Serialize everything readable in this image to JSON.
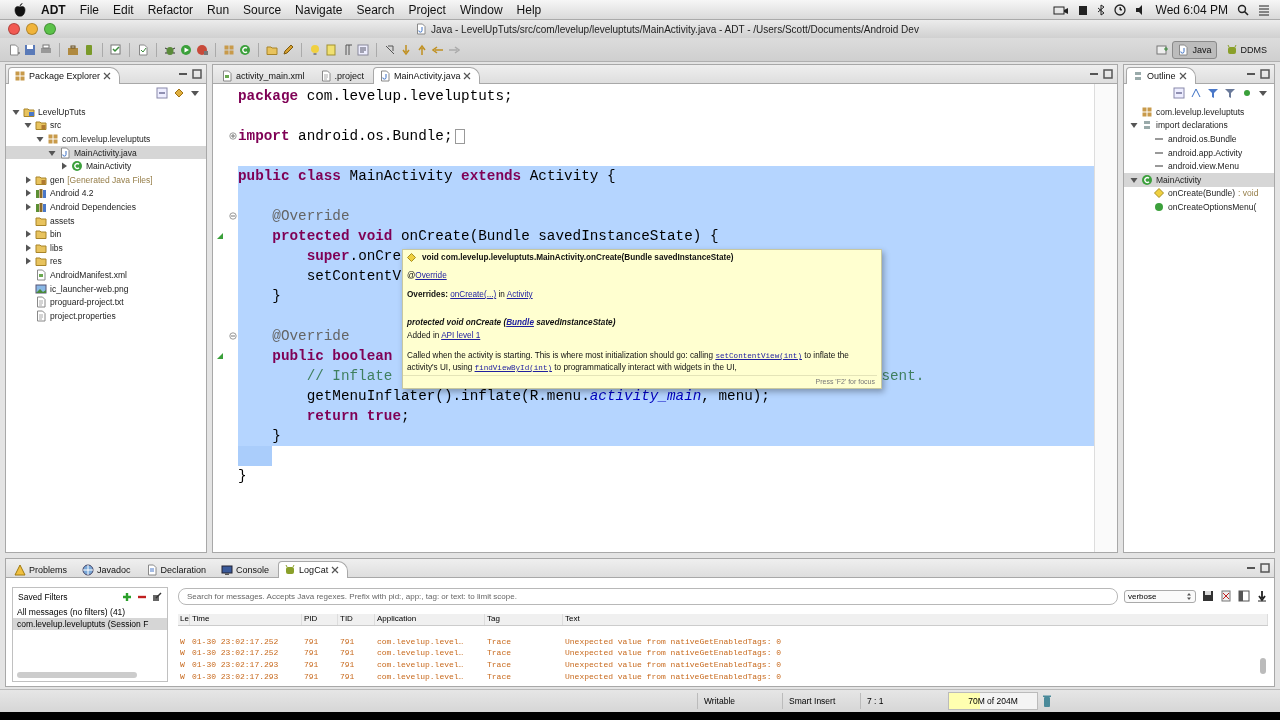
{
  "menu_bar": {
    "items": [
      "ADT",
      "File",
      "Edit",
      "Refactor",
      "Run",
      "Source",
      "Navigate",
      "Search",
      "Project",
      "Window",
      "Help"
    ],
    "clock": "Wed 6:04 PM"
  },
  "window": {
    "title": "Java - LevelUpTuts/src/com/levelup/leveluptuts/MainActivity.java - ADT - /Users/Scott/Documents/Android Dev"
  },
  "toolbar": {
    "perspectives": [
      {
        "label": "Java",
        "selected": true
      },
      {
        "label": "DDMS",
        "selected": false
      }
    ]
  },
  "package_explorer": {
    "title": "Package Explorer",
    "tree": [
      {
        "label": "LevelUpTuts",
        "kind": "project",
        "expanded": true,
        "selected": false,
        "children": [
          {
            "label": "src",
            "kind": "source-folder",
            "expanded": true,
            "selected": false,
            "children": [
              {
                "label": "com.levelup.leveluptuts",
                "kind": "package",
                "expanded": true,
                "selected": false,
                "children": [
                  {
                    "label": "MainActivity.java",
                    "kind": "java-file",
                    "expanded": true,
                    "selected": true,
                    "children": [
                      {
                        "label": "MainActivity",
                        "kind": "class",
                        "expanded": false,
                        "selected": false
                      }
                    ]
                  }
                ]
              }
            ]
          },
          {
            "label": "gen",
            "note": "[Generated Java Files]",
            "kind": "source-folder",
            "expanded": false,
            "selected": false
          },
          {
            "label": "Android 4.2",
            "kind": "library",
            "expanded": false,
            "selected": false
          },
          {
            "label": "Android Dependencies",
            "kind": "library",
            "expanded": false,
            "selected": false
          },
          {
            "label": "assets",
            "kind": "folder",
            "selected": false
          },
          {
            "label": "bin",
            "kind": "folder",
            "expanded": false,
            "selected": false
          },
          {
            "label": "libs",
            "kind": "folder",
            "expanded": false,
            "selected": false
          },
          {
            "label": "res",
            "kind": "folder",
            "expanded": false,
            "selected": false
          },
          {
            "label": "AndroidManifest.xml",
            "kind": "xml-file",
            "selected": false
          },
          {
            "label": "ic_launcher-web.png",
            "kind": "image-file",
            "selected": false
          },
          {
            "label": "proguard-project.txt",
            "kind": "text-file",
            "selected": false
          },
          {
            "label": "project.properties",
            "kind": "text-file",
            "selected": false
          }
        ]
      }
    ]
  },
  "editor": {
    "tabs": [
      {
        "label": "activity_main.xml",
        "kind": "xml-file",
        "selected": false
      },
      {
        "label": ".project",
        "kind": "text-file",
        "selected": false
      },
      {
        "label": "MainActivity.java",
        "kind": "java-file",
        "selected": true
      }
    ],
    "lines": [
      {
        "selected": false,
        "partial": false,
        "foldable": false,
        "folded": false,
        "overrides": false,
        "tokens": [
          {
            "text": "package",
            "kind": "keyword"
          },
          {
            "text": " com.levelup.leveluptuts;",
            "kind": "plain"
          }
        ]
      },
      {
        "selected": false,
        "partial": false,
        "foldable": false,
        "folded": false,
        "overrides": false
      },
      {
        "selected": false,
        "partial": false,
        "foldable": true,
        "folded": true,
        "overrides": false,
        "tokens": [
          {
            "text": "import",
            "kind": "keyword"
          },
          {
            "text": " android.os.Bundle;",
            "kind": "plain"
          }
        ]
      },
      {
        "selected": false,
        "partial": false,
        "foldable": false,
        "folded": false,
        "overrides": false
      },
      {
        "selected": true,
        "partial": false,
        "foldable": false,
        "folded": false,
        "overrides": false,
        "tokens": [
          {
            "text": "public class",
            "kind": "keyword"
          },
          {
            "text": " MainActivity ",
            "kind": "plain"
          },
          {
            "text": "extends",
            "kind": "keyword"
          },
          {
            "text": " Activity {",
            "kind": "plain"
          }
        ]
      },
      {
        "selected": true,
        "partial": false,
        "foldable": false,
        "folded": false,
        "overrides": false
      },
      {
        "selected": true,
        "partial": false,
        "foldable": true,
        "folded": false,
        "overrides": false,
        "tokens": [
          {
            "text": "    @Override",
            "kind": "annotation"
          }
        ]
      },
      {
        "selected": true,
        "partial": false,
        "foldable": false,
        "folded": false,
        "overrides": true,
        "tokens": [
          {
            "text": "    protected void",
            "kind": "keyword"
          },
          {
            "text": " onCreate(Bundle savedInstanceState) {",
            "kind": "plain"
          }
        ]
      },
      {
        "selected": true,
        "partial": false,
        "foldable": false,
        "folded": false,
        "overrides": false,
        "tokens": [
          {
            "text": "        super",
            "kind": "keyword"
          },
          {
            "text": ".onCre",
            "kind": "plain"
          }
        ]
      },
      {
        "selected": true,
        "partial": false,
        "foldable": false,
        "folded": false,
        "overrides": false,
        "tokens": [
          {
            "text": "        setContentV",
            "kind": "plain"
          }
        ]
      },
      {
        "selected": true,
        "partial": false,
        "foldable": false,
        "folded": false,
        "overrides": false,
        "tokens": [
          {
            "text": "    }",
            "kind": "plain"
          }
        ]
      },
      {
        "selected": true,
        "partial": false,
        "foldable": false,
        "folded": false,
        "overrides": false
      },
      {
        "selected": true,
        "partial": false,
        "foldable": true,
        "folded": false,
        "overrides": false,
        "tokens": [
          {
            "text": "    @Override",
            "kind": "annotation"
          }
        ]
      },
      {
        "selected": true,
        "partial": false,
        "foldable": false,
        "folded": false,
        "overrides": true,
        "tokens": [
          {
            "text": "    public boolean",
            "kind": "keyword"
          }
        ]
      },
      {
        "selected": true,
        "partial": false,
        "foldable": false,
        "folded": false,
        "overrides": false,
        "tokens": [
          {
            "text": "        // Inflate",
            "kind": "comment"
          },
          {
            "text": "sent.",
            "kind": "comment_tail"
          }
        ]
      },
      {
        "selected": true,
        "partial": false,
        "foldable": false,
        "folded": false,
        "overrides": false,
        "tokens": [
          {
            "text": "        getMenuInflater().inflate(R.menu.",
            "kind": "plain"
          },
          {
            "text": "activity_main",
            "kind": "field"
          },
          {
            "text": ", menu);",
            "kind": "plain"
          }
        ]
      },
      {
        "selected": true,
        "partial": false,
        "foldable": false,
        "folded": false,
        "overrides": false,
        "tokens": [
          {
            "text": "        return true",
            "kind": "keyword"
          },
          {
            "text": ";",
            "kind": "plain"
          }
        ]
      },
      {
        "selected": true,
        "partial": false,
        "foldable": false,
        "folded": false,
        "overrides": false,
        "tokens": [
          {
            "text": "    }",
            "kind": "plain"
          }
        ]
      },
      {
        "selected": false,
        "partial": true,
        "foldable": false,
        "folded": false,
        "overrides": false
      },
      {
        "selected": false,
        "partial": false,
        "foldable": false,
        "folded": false,
        "overrides": false,
        "tokens": [
          {
            "text": "}",
            "kind": "plain"
          }
        ]
      }
    ],
    "popup": {
      "header": "void com.levelup.leveluptuts.MainActivity.onCreate(Bundle savedInstanceState)",
      "paragraphs": [
        {
          "kind": "annotation",
          "segments": [
            {
              "text": "@",
              "kind": "text"
            },
            {
              "text": "Override",
              "kind": "link"
            }
          ]
        },
        {
          "kind": "overrides",
          "segments": [
            {
              "text": "Overrides: ",
              "kind": "bold"
            },
            {
              "text": "onCreate(...)",
              "kind": "link"
            },
            {
              "text": " in ",
              "kind": "text"
            },
            {
              "text": "Activity",
              "kind": "link"
            }
          ]
        },
        {
          "kind": "signature",
          "segments": [
            {
              "text": "protected void onCreate (",
              "kind": "text"
            },
            {
              "text": "Bundle",
              "kind": "link"
            },
            {
              "text": " savedInstanceState)",
              "kind": "text"
            }
          ]
        },
        {
          "kind": "since",
          "segments": [
            {
              "text": "Added in ",
              "kind": "text"
            },
            {
              "text": "API level 1",
              "kind": "link"
            }
          ]
        },
        {
          "kind": "description",
          "segments": [
            {
              "text": "Called when the activity is starting. This is where most initialization should go: calling ",
              "kind": "text"
            },
            {
              "text": "setContentView(int)",
              "kind": "code_link"
            },
            {
              "text": " to inflate the activity's UI, using ",
              "kind": "text"
            },
            {
              "text": "findViewById(int)",
              "kind": "code_link"
            },
            {
              "text": " to programmatically interact with widgets in the UI,",
              "kind": "text"
            }
          ]
        }
      ],
      "footer": "Press 'F2' for focus"
    }
  },
  "outline": {
    "title": "Outline",
    "tree": [
      {
        "label": "com.levelup.leveluptuts",
        "kind": "package",
        "selected": false
      },
      {
        "label": "import declarations",
        "kind": "imports",
        "expanded": true,
        "selected": false,
        "children": [
          {
            "label": "android.os.Bundle",
            "kind": "import",
            "selected": false
          },
          {
            "label": "android.app.Activity",
            "kind": "import",
            "selected": false
          },
          {
            "label": "android.view.Menu",
            "kind": "import",
            "selected": false
          }
        ]
      },
      {
        "label": "MainActivity",
        "kind": "class",
        "expanded": true,
        "selected": true,
        "children": [
          {
            "label": "onCreate(Bundle)",
            "note": ": void",
            "kind": "protected-method",
            "selected": false
          },
          {
            "label": "onCreateOptionsMenu(",
            "kind": "public-method",
            "selected": false
          }
        ]
      }
    ]
  },
  "bottom_panel": {
    "tabs": [
      {
        "label": "Problems",
        "kind": "problems",
        "selected": false
      },
      {
        "label": "Javadoc",
        "kind": "javadoc",
        "selected": false
      },
      {
        "label": "Declaration",
        "kind": "declaration",
        "selected": false
      },
      {
        "label": "Console",
        "kind": "console",
        "selected": false
      },
      {
        "label": "LogCat",
        "kind": "logcat",
        "selected": true
      }
    ],
    "saved_filters": {
      "title": "Saved Filters",
      "items": [
        {
          "label": "All messages (no filters) (41)",
          "selected": false
        },
        {
          "label": "com.levelup.leveluptuts (Session F",
          "selected": true
        }
      ]
    },
    "search": {
      "placeholder": "Search for messages. Accepts Java regexes. Prefix with pid:, app:, tag: or text: to limit scope."
    },
    "level_select": "verbose",
    "log_table": {
      "columns": [
        "Le",
        "Time",
        "PID",
        "TID",
        "Application",
        "Tag",
        "Text"
      ],
      "rows": [
        [
          "W",
          "01-30 23:02:17.252",
          "791",
          "791",
          "com.levelup.level…",
          "Trace",
          "Unexpected value from nativeGetEnabledTags: 0"
        ],
        [
          "W",
          "01-30 23:02:17.252",
          "791",
          "791",
          "com.levelup.level…",
          "Trace",
          "Unexpected value from nativeGetEnabledTags: 0"
        ],
        [
          "W",
          "01-30 23:02:17.293",
          "791",
          "791",
          "com.levelup.level…",
          "Trace",
          "Unexpected value from nativeGetEnabledTags: 0"
        ],
        [
          "W",
          "01-30 23:02:17.293",
          "791",
          "791",
          "com.levelup.level…",
          "Trace",
          "Unexpected value from nativeGetEnabledTags: 0"
        ]
      ]
    }
  },
  "status_bar": {
    "items": [
      "Writable",
      "Smart Insert",
      "7 : 1"
    ],
    "memory": {
      "text": "70M of 204M",
      "level": 0.35
    }
  }
}
